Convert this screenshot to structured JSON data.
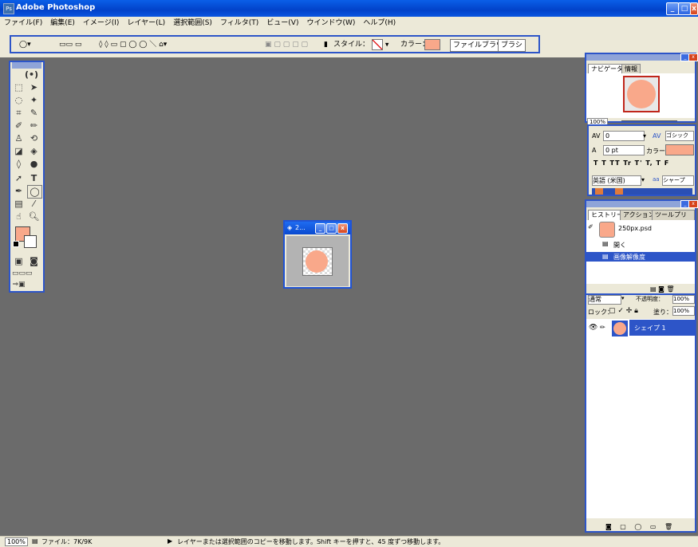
{
  "titlebar": {
    "title": "Adobe Photoshop",
    "minimize": "_",
    "maximize": "□",
    "close": "x"
  },
  "menu": [
    "ファイル(F)",
    "編集(E)",
    "イメージ(I)",
    "レイヤー(L)",
    "選択範囲(S)",
    "フィルタ(T)",
    "ビュー(V)",
    "ウインドウ(W)",
    "ヘルプ(H)"
  ],
  "options": {
    "style_label": "スタイル：",
    "color_label": "カラー：",
    "tab_file_browser": "ファイルブラウザ",
    "tab_brush": "ブラシ",
    "color": "#f9a88a"
  },
  "navigator": {
    "tab1": "ナビゲータ",
    "tab2": "情報",
    "zoom": "100%"
  },
  "character": {
    "tracking_value": "0",
    "font_name": "ゴシック",
    "baseline_value": "0 pt",
    "color_label": "カラー：",
    "style_buttons": "T T TT Tr T' T, T F",
    "language": "英語 (米国)",
    "antialias_icon": "aa",
    "antialias": "シャープ"
  },
  "history": {
    "tab1": "ヒストリー",
    "tab2": "アクション",
    "tab3": "ツールプリセット",
    "snapshot": "250px.psd",
    "items": [
      "開く",
      "画像解像度"
    ]
  },
  "layers": {
    "mode": "通常",
    "opacity_label": "不透明度：",
    "opacity": "100%",
    "lock_label": "ロック：",
    "fill_label": "塗り：",
    "fill": "100%",
    "layer_name": "シェイプ 1"
  },
  "docwin": {
    "title": "2..."
  },
  "status": {
    "zoom": "100%",
    "file": "ファイル：7K/9K",
    "message": "レイヤーまたは選択範囲のコピーを移動します。Shift キーを押すと、45 度ずつ移動します。"
  },
  "colors": {
    "accent": "#2d55c8",
    "fg_swatch": "#f9a88a",
    "canvas": "#6b6b6b"
  }
}
